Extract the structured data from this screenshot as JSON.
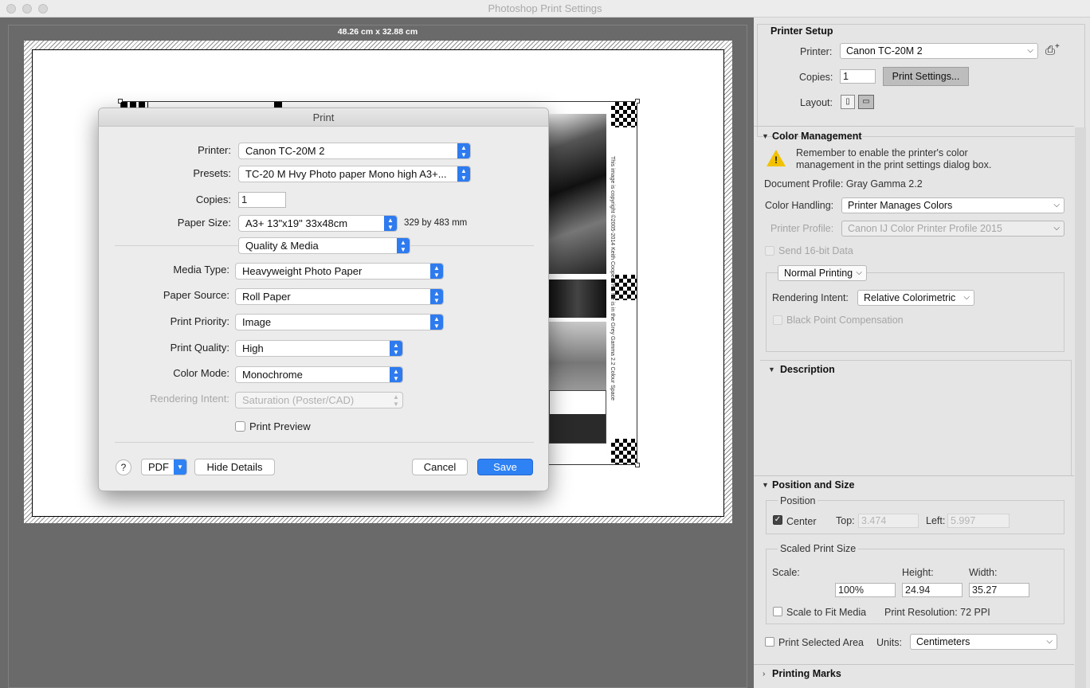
{
  "window": {
    "title": "Photoshop Print Settings"
  },
  "preview": {
    "dimensions": "48.26 cm x 32.88 cm",
    "image_side_text": "This image is copyright ©2005-2014 Keith Cooper   This file is in the Grey Gamma 2.2 Colour Space"
  },
  "print_dialog": {
    "title": "Print",
    "printer_label": "Printer:",
    "printer_value": "Canon TC-20M 2",
    "presets_label": "Presets:",
    "presets_value": "TC-20 M Hvy Photo paper Mono high A3+...",
    "copies_label": "Copies:",
    "copies_value": "1",
    "paper_size_label": "Paper Size:",
    "paper_size_value": "A3+ 13\"x19\" 33x48cm",
    "paper_size_info": "329 by 483 mm",
    "pane_value": "Quality & Media",
    "media_type_label": "Media Type:",
    "media_type_value": "Heavyweight Photo Paper",
    "paper_source_label": "Paper Source:",
    "paper_source_value": "Roll Paper",
    "print_priority_label": "Print Priority:",
    "print_priority_value": "Image",
    "print_quality_label": "Print Quality:",
    "print_quality_value": "High",
    "color_mode_label": "Color Mode:",
    "color_mode_value": "Monochrome",
    "rendering_intent_label": "Rendering Intent:",
    "rendering_intent_value": "Saturation (Poster/CAD)",
    "print_preview_label": "Print Preview",
    "help_label": "?",
    "pdf_label": "PDF",
    "hide_details_label": "Hide Details",
    "cancel_label": "Cancel",
    "save_label": "Save",
    "accent_color": "#2f82f3"
  },
  "printer_setup": {
    "heading": "Printer Setup",
    "printer_label": "Printer:",
    "printer_value": "Canon TC-20M 2",
    "copies_label": "Copies:",
    "copies_value": "1",
    "print_settings_label": "Print Settings...",
    "layout_label": "Layout:"
  },
  "color_management": {
    "heading": "Color Management",
    "warning_text_1": "Remember to enable the printer's color",
    "warning_text_2": "management in the print settings dialog box.",
    "document_profile": "Document Profile: Gray Gamma 2.2",
    "color_handling_label": "Color Handling:",
    "color_handling_value": "Printer Manages Colors",
    "printer_profile_label": "Printer Profile:",
    "printer_profile_value": "Canon IJ Color Printer Profile 2015",
    "send_16bit_label": "Send 16-bit Data",
    "normal_printing_value": "Normal Printing",
    "rendering_intent_label": "Rendering Intent:",
    "rendering_intent_value": "Relative Colorimetric",
    "black_point_label": "Black Point Compensation"
  },
  "description": {
    "heading": "Description"
  },
  "position_size": {
    "heading": "Position and Size",
    "position_label": "Position",
    "center_label": "Center",
    "top_label": "Top:",
    "top_value": "3.474",
    "left_label": "Left:",
    "left_value": "5.997",
    "scaled_label": "Scaled Print Size",
    "scale_label": "Scale:",
    "scale_value": "100%",
    "height_label": "Height:",
    "height_value": "24.94",
    "width_label": "Width:",
    "width_value": "35.27",
    "scale_fit_label": "Scale to Fit Media",
    "print_resolution": "Print Resolution: 72 PPI",
    "print_selected_label": "Print Selected Area",
    "units_label": "Units:",
    "units_value": "Centimeters"
  },
  "printing_marks": {
    "heading": "Printing Marks"
  }
}
